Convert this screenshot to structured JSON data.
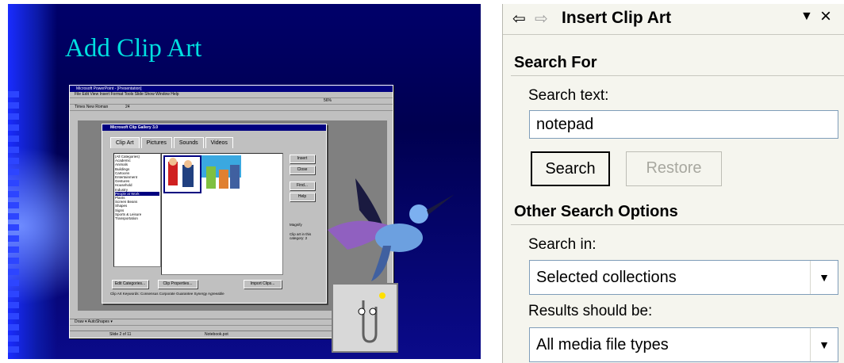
{
  "slide": {
    "title": "Add Clip Art",
    "app_title": "Microsoft PowerPoint - [Presentation]",
    "menu": "File  Edit  View  Insert  Format  Tools  Slide Show  Window  Help",
    "font_name": "Times New Roman",
    "font_size": "24",
    "zoom": "56%",
    "gallery": {
      "title": "Microsoft Clip Gallery 3.0",
      "tabs": [
        "Clip Art",
        "Pictures",
        "Sounds",
        "Videos"
      ],
      "categories": [
        "(All Categories)",
        "Academic",
        "Animals",
        "Buildings",
        "Cartoons",
        "Entertainment",
        "Gestures",
        "Household",
        "Industry",
        "People at Work",
        "Plants",
        "Screen Beans",
        "Shapes",
        "Signs",
        "Sports & Leisure",
        "Transportation"
      ],
      "selected_category": "People at Work",
      "buttons": [
        "Insert",
        "Close",
        "Find...",
        "Help"
      ],
      "magnify": "Magnify",
      "count_text": "Clip art in this category: 2",
      "bottom_buttons": [
        "Edit Categories...",
        "Clip Properties...",
        "Import Clips..."
      ],
      "keywords": "Clip Art Keywords:  Consensus Corporate Guarantee Synergy Agreeable"
    },
    "status": [
      "Slide 2 of 11",
      "Notebook.pot"
    ],
    "draw_toolbar": "Draw ▾   AutoShapes ▾"
  },
  "pane": {
    "title": "Insert Clip Art",
    "search_for": "Search For",
    "search_text_label": "Search text:",
    "search_text_value": "notepad",
    "search_button": "Search",
    "restore_button": "Restore",
    "other_options": "Other Search Options",
    "search_in_label": "Search in:",
    "search_in_value": "Selected collections",
    "results_label": "Results should be:",
    "results_value": "All media file types"
  }
}
